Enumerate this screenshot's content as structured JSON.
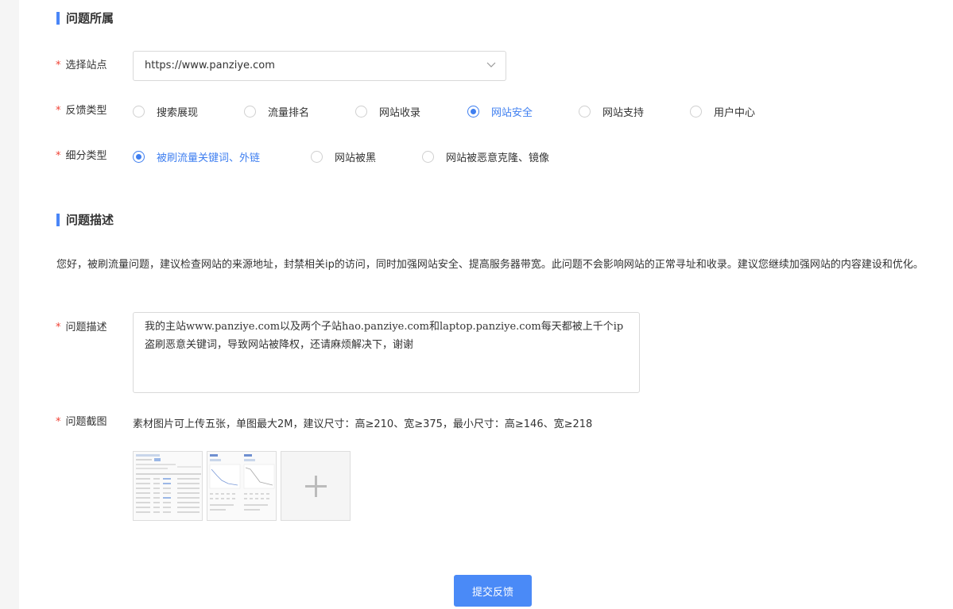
{
  "section1": {
    "title": "问题所属"
  },
  "site": {
    "label": "选择站点",
    "value": "https://www.panziye.com"
  },
  "feedback": {
    "label": "反馈类型",
    "options": [
      "搜索展现",
      "流量排名",
      "网站收录",
      "网站安全",
      "网站支持",
      "用户中心"
    ],
    "selected": "网站安全"
  },
  "subtype": {
    "label": "细分类型",
    "options": [
      "被刷流量关键词、外链",
      "网站被黑",
      "网站被恶意克隆、镜像"
    ],
    "selected": "被刷流量关键词、外链"
  },
  "section2": {
    "title": "问题描述",
    "notice": "您好，被刷流量问题，建议检查网站的来源地址，封禁相关ip的访问，同时加强网站安全、提高服务器带宽。此问题不会影响网站的正常寻址和收录。建议您继续加强网站的内容建设和优化。"
  },
  "description": {
    "label": "问题描述",
    "value": "我的主站www.panziye.com以及两个子站hao.panziye.com和laptop.panziye.com每天都被上千个ip盗刷恶意关键词，导致网站被降权，还请麻烦解决下，谢谢"
  },
  "screenshot": {
    "label": "问题截图",
    "hint": "素材图片可上传五张，单图最大2M，建议尺寸：高≥210、宽≥375，最小尺寸：高≥146、宽≥218"
  },
  "submit": {
    "label": "提交反馈"
  },
  "required_mark": "*",
  "colors": {
    "accent": "#3f7ff0",
    "required": "#f04134",
    "button": "#4a8af7"
  }
}
